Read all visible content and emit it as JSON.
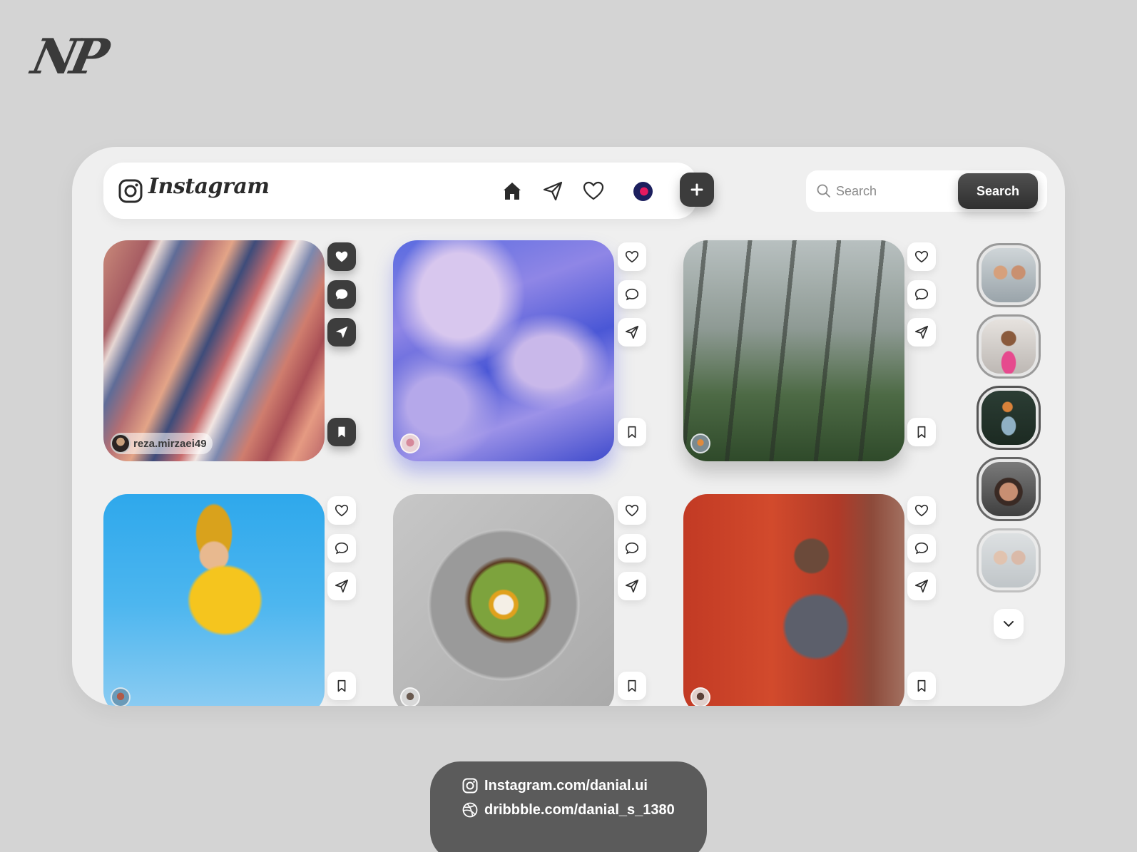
{
  "brand": {
    "monogram": "NP"
  },
  "app": {
    "wordmark": "Instagram"
  },
  "nav": {
    "icons": [
      "home-icon",
      "send-icon",
      "heart-icon",
      "avatar"
    ]
  },
  "search": {
    "placeholder": "Search",
    "button_label": "Search"
  },
  "posts": [
    {
      "owner": "reza.mirzaei49",
      "subject": "abstract fluid art",
      "liked": true
    },
    {
      "owner": "",
      "subject": "blue fabric",
      "liked": false
    },
    {
      "owner": "",
      "subject": "misty forest",
      "liked": false
    },
    {
      "owner": "",
      "subject": "woman with tablet",
      "liked": false
    },
    {
      "owner": "",
      "subject": "avocado toast",
      "liked": false
    },
    {
      "owner": "",
      "subject": "man by red wall",
      "liked": false
    }
  ],
  "stories": {
    "count": 5,
    "active_index": 2
  },
  "contact": {
    "instagram": "Instagram.com/danial.ui",
    "dribbble": "dribbble.com/danial_s_1380"
  },
  "colors": {
    "background": "#d4d4d4",
    "panel": "#efefef",
    "dark_button": "#3c3c3c"
  }
}
